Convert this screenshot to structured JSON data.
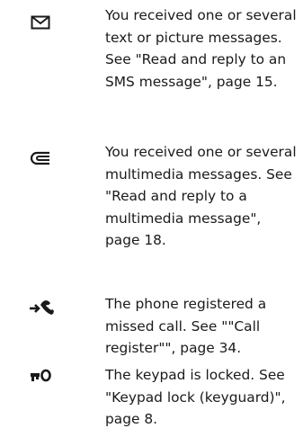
{
  "entries": [
    {
      "icon": "envelope-icon",
      "text": "You received one or several\ntext or picture messages.\nSee \"Read and reply to an\nSMS message\", page 15."
    },
    {
      "icon": "multimedia-message-icon",
      "text": "You received one or several\nmultimedia messages. See\n\"Read and reply to a\nmultimedia message\",\npage 18."
    },
    {
      "icon": "missed-call-icon",
      "text": "The phone registered a\nmissed call. See \"\"Call\nregister\"\", page 34."
    },
    {
      "icon": "key-lock-icon",
      "text": "The keypad is locked. See\n\"Keypad lock (keyguard)\",\npage 8."
    }
  ]
}
